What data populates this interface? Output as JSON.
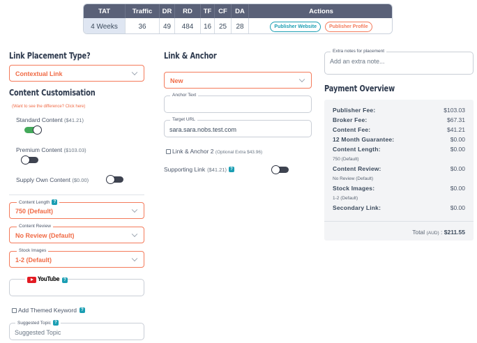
{
  "metrics": {
    "headers": [
      "TAT",
      "Traffic",
      "DR",
      "RD",
      "TF",
      "CF",
      "DA",
      "Actions"
    ],
    "values": {
      "tat": "4 Weeks",
      "traffic": "36",
      "dr": "49",
      "rd": "484",
      "tf": "16",
      "cf": "25",
      "da": "28"
    },
    "publisher_website_label": "Publisher Website",
    "publisher_profile_label": "Publisher Profile"
  },
  "placement": {
    "title": "Link Placement Type?",
    "selected": "Contextual Link"
  },
  "customisation": {
    "title": "Content Customisation",
    "difference_link": "(Want to see the difference? Click here)",
    "options": [
      {
        "label": "Standard Content",
        "price": "($41.21)",
        "on": true
      },
      {
        "label": "Premium Content",
        "price": "($103.03)",
        "on": false
      },
      {
        "label": "Supply Own Content",
        "price": "($0.00)",
        "on": false
      }
    ],
    "content_length": {
      "label": "Content Length",
      "value": "750 (Default)"
    },
    "content_review": {
      "label": "Content Review",
      "value": "No Review (Default)"
    },
    "stock_images": {
      "label": "Stock Images",
      "value": "1-2 (Default)"
    },
    "youtube_label": "YouTube",
    "themed_keyword_label": "Add Themed Keyword",
    "suggested_topic": {
      "label": "Suggested Topic",
      "placeholder": "Suggested Topic"
    }
  },
  "link_anchor": {
    "title": "Link & Anchor",
    "selected": "New",
    "anchor_text_label": "Anchor Text",
    "anchor_text_value": "",
    "target_url_label": "Target URL",
    "target_url_value": "sara.sara.nobs.test.com",
    "link_anchor_2_label": "Link & Anchor 2",
    "link_anchor_2_extra": "(Optional Extra $43.96)",
    "supporting_link_label": "Supporting Link",
    "supporting_link_price": "($41.21)"
  },
  "notes": {
    "label": "Extra notes for placement",
    "placeholder": "Add an extra note..."
  },
  "payment": {
    "title": "Payment Overview",
    "rows": [
      {
        "label": "Publisher Fee:",
        "value": "$103.03"
      },
      {
        "label": "Broker Fee:",
        "value": "$67.31"
      },
      {
        "label": "Content Fee:",
        "value": "$41.21"
      },
      {
        "label": "12 Month Guarantee:",
        "value": "$0.00"
      },
      {
        "label": "Content Length:",
        "value": "$0.00",
        "sub": "750 (Default)"
      },
      {
        "label": "Content Review:",
        "value": "$0.00",
        "sub": "No Review (Default)"
      },
      {
        "label": "Stock Images:",
        "value": "$0.00",
        "sub": "1-2 (Default)"
      },
      {
        "label": "Secondary Link:",
        "value": "$0.00"
      }
    ],
    "total_label": "Total",
    "total_currency": "(AUD)",
    "total_value": "$211.55"
  },
  "colors": {
    "accent": "#f47a5a",
    "teal": "#1a9eb3",
    "toggle_on": "#43a95a",
    "header_bg": "#5a6178"
  }
}
